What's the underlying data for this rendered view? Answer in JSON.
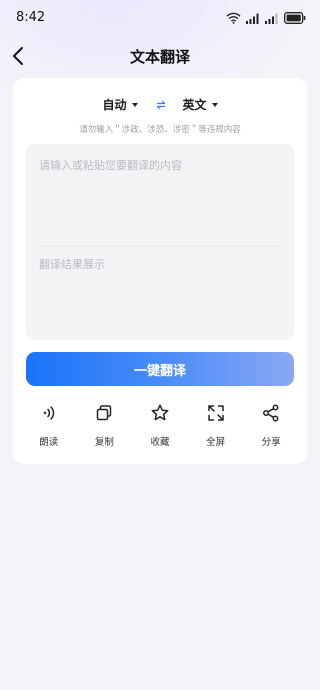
{
  "status_bar": {
    "time": "8:42",
    "icons": [
      "wifi-icon",
      "signal-icon",
      "signal-icon",
      "battery-icon"
    ]
  },
  "nav": {
    "title": "文本翻译",
    "back_icon": "back-arrow-icon"
  },
  "translator": {
    "source_lang": "自动",
    "target_lang": "英文",
    "swap_icon": "swap-icon",
    "notice": "请勿输入＂涉政、涉恐、涉密＂等违规内容",
    "input_placeholder": "请输入或粘贴您要翻译的内容",
    "result_placeholder": "翻译结果展示",
    "translate_button": "一键翻译"
  },
  "actions": [
    {
      "label": "朗读",
      "icon": "speaker-icon"
    },
    {
      "label": "复制",
      "icon": "copy-icon"
    },
    {
      "label": "收藏",
      "icon": "star-icon"
    },
    {
      "label": "全屏",
      "icon": "fullscreen-icon"
    },
    {
      "label": "分享",
      "icon": "share-icon"
    }
  ],
  "colors": {
    "background": "#f3f4f8",
    "card": "#ffffff",
    "text_area": "#f2f3f5",
    "accent": "#1a73f8",
    "button_gradient_end": "#8aa8f2",
    "placeholder": "#b8bbc2"
  }
}
